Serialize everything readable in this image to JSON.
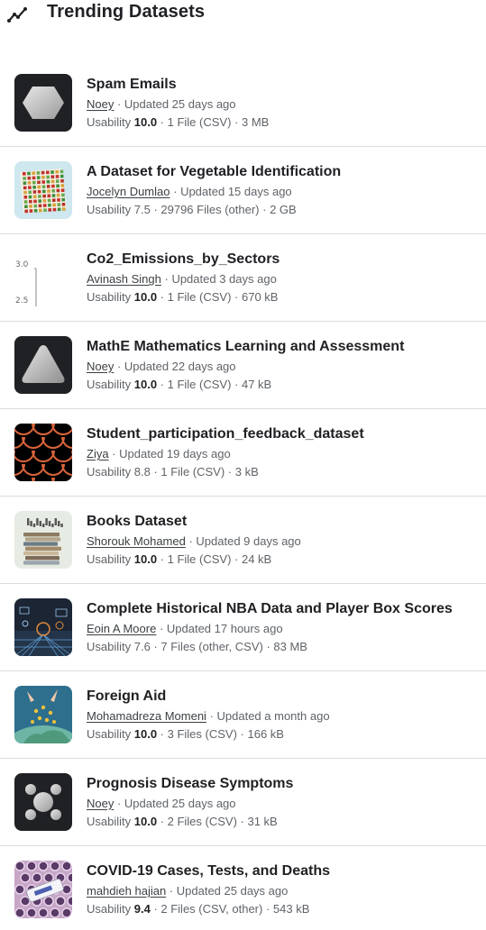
{
  "header": {
    "title": "Trending Datasets",
    "icon": "trending-icon"
  },
  "sep": " · ",
  "datasets": [
    {
      "title": "Spam Emails",
      "author": "Noey",
      "updated": "Updated 25 days ago",
      "usability_label": "Usability",
      "usability": "10.0",
      "usability_bold": true,
      "files": "1 File (CSV)",
      "size": "3 MB",
      "thumb": "hexagon"
    },
    {
      "title": "A Dataset for Vegetable Identification",
      "author": "Jocelyn Dumlao",
      "updated": "Updated 15 days ago",
      "usability_label": "Usability",
      "usability": "7.5",
      "usability_bold": false,
      "files": "29796 Files (other)",
      "size": "2 GB",
      "thumb": "vegetables"
    },
    {
      "title": "Co2_Emissions_by_Sectors",
      "author": "Avinash Singh",
      "updated": "Updated 3 days ago",
      "usability_label": "Usability",
      "usability": "10.0",
      "usability_bold": true,
      "files": "1 File (CSV)",
      "size": "670 kB",
      "thumb": "axis",
      "thumb_labels": [
        "3.0",
        "2.5"
      ]
    },
    {
      "title": "MathE Mathematics Learning and Assessment",
      "author": "Noey",
      "updated": "Updated 22 days ago",
      "usability_label": "Usability",
      "usability": "10.0",
      "usability_bold": true,
      "files": "1 File (CSV)",
      "size": "47 kB",
      "thumb": "triangle"
    },
    {
      "title": "Student_participation_feedback_dataset",
      "author": "Ziya",
      "updated": "Updated 19 days ago",
      "usability_label": "Usability",
      "usability": "8.8",
      "usability_bold": false,
      "files": "1 File (CSV)",
      "size": "3 kB",
      "thumb": "scales"
    },
    {
      "title": "Books Dataset",
      "author": "Shorouk Mohamed",
      "updated": "Updated 9 days ago",
      "usability_label": "Usability",
      "usability": "10.0",
      "usability_bold": true,
      "files": "1 File (CSV)",
      "size": "24 kB",
      "thumb": "books"
    },
    {
      "title": "Complete Historical NBA Data and Player Box Scores",
      "author": "Eoin A Moore",
      "updated": "Updated 17 hours ago",
      "usability_label": "Usability",
      "usability": "7.6",
      "usability_bold": false,
      "files": "7 Files (other, CSV)",
      "size": "83 MB",
      "thumb": "nba"
    },
    {
      "title": "Foreign Aid",
      "author": "Mohamadreza Momeni",
      "updated": "Updated a month ago",
      "usability_label": "Usability",
      "usability": "10.0",
      "usability_bold": true,
      "files": "3 Files (CSV)",
      "size": "166 kB",
      "thumb": "aid"
    },
    {
      "title": "Prognosis Disease Symptoms",
      "author": "Noey",
      "updated": "Updated 25 days ago",
      "usability_label": "Usability",
      "usability": "10.0",
      "usability_bold": true,
      "files": "2 Files (CSV)",
      "size": "31 kB",
      "thumb": "dots"
    },
    {
      "title": "COVID-19 Cases, Tests, and Deaths",
      "author": "mahdieh hajian",
      "updated": "Updated 25 days ago",
      "usability_label": "Usability",
      "usability": "9.4",
      "usability_bold": true,
      "files": "2 Files (CSV, other)",
      "size": "543 kB",
      "thumb": "covid"
    }
  ]
}
